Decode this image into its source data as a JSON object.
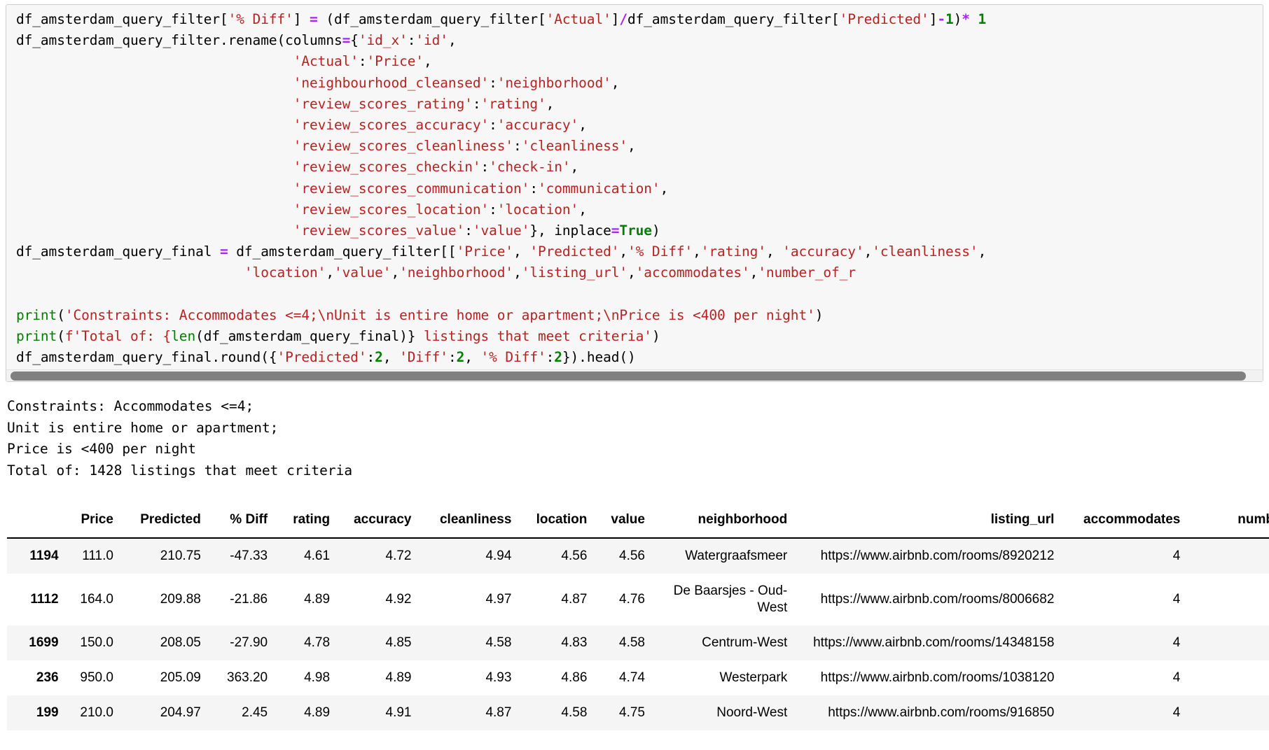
{
  "notebook": {
    "code_cell": {
      "lines": [
        [
          {
            "t": "df_amsterdam_query_filter[",
            "c": "plain"
          },
          {
            "t": "'% Diff'",
            "c": "str"
          },
          {
            "t": "] ",
            "c": "plain"
          },
          {
            "t": "=",
            "c": "op"
          },
          {
            "t": " (df_amsterdam_query_filter[",
            "c": "plain"
          },
          {
            "t": "'Actual'",
            "c": "str"
          },
          {
            "t": "]",
            "c": "plain"
          },
          {
            "t": "/",
            "c": "op"
          },
          {
            "t": "df_amsterdam_query_filter[",
            "c": "plain"
          },
          {
            "t": "'Predicted'",
            "c": "str"
          },
          {
            "t": "]",
            "c": "plain"
          },
          {
            "t": "-",
            "c": "op"
          },
          {
            "t": "1",
            "c": "num"
          },
          {
            "t": ")",
            "c": "plain"
          },
          {
            "t": "*",
            "c": "op"
          },
          {
            "t": " 1",
            "c": "num"
          }
        ],
        [
          {
            "t": "df_amsterdam_query_filter.rename(columns",
            "c": "plain"
          },
          {
            "t": "=",
            "c": "op"
          },
          {
            "t": "{",
            "c": "plain"
          },
          {
            "t": "'id_x'",
            "c": "str"
          },
          {
            "t": ":",
            "c": "plain"
          },
          {
            "t": "'id'",
            "c": "str"
          },
          {
            "t": ",",
            "c": "plain"
          }
        ],
        [
          {
            "t": "                                  ",
            "c": "plain"
          },
          {
            "t": "'Actual'",
            "c": "str"
          },
          {
            "t": ":",
            "c": "plain"
          },
          {
            "t": "'Price'",
            "c": "str"
          },
          {
            "t": ",",
            "c": "plain"
          }
        ],
        [
          {
            "t": "                                  ",
            "c": "plain"
          },
          {
            "t": "'neighbourhood_cleansed'",
            "c": "str"
          },
          {
            "t": ":",
            "c": "plain"
          },
          {
            "t": "'neighborhood'",
            "c": "str"
          },
          {
            "t": ",",
            "c": "plain"
          }
        ],
        [
          {
            "t": "                                  ",
            "c": "plain"
          },
          {
            "t": "'review_scores_rating'",
            "c": "str"
          },
          {
            "t": ":",
            "c": "plain"
          },
          {
            "t": "'rating'",
            "c": "str"
          },
          {
            "t": ",",
            "c": "plain"
          }
        ],
        [
          {
            "t": "                                  ",
            "c": "plain"
          },
          {
            "t": "'review_scores_accuracy'",
            "c": "str"
          },
          {
            "t": ":",
            "c": "plain"
          },
          {
            "t": "'accuracy'",
            "c": "str"
          },
          {
            "t": ",",
            "c": "plain"
          }
        ],
        [
          {
            "t": "                                  ",
            "c": "plain"
          },
          {
            "t": "'review_scores_cleanliness'",
            "c": "str"
          },
          {
            "t": ":",
            "c": "plain"
          },
          {
            "t": "'cleanliness'",
            "c": "str"
          },
          {
            "t": ",",
            "c": "plain"
          }
        ],
        [
          {
            "t": "                                  ",
            "c": "plain"
          },
          {
            "t": "'review_scores_checkin'",
            "c": "str"
          },
          {
            "t": ":",
            "c": "plain"
          },
          {
            "t": "'check-in'",
            "c": "str"
          },
          {
            "t": ",",
            "c": "plain"
          }
        ],
        [
          {
            "t": "                                  ",
            "c": "plain"
          },
          {
            "t": "'review_scores_communication'",
            "c": "str"
          },
          {
            "t": ":",
            "c": "plain"
          },
          {
            "t": "'communication'",
            "c": "str"
          },
          {
            "t": ",",
            "c": "plain"
          }
        ],
        [
          {
            "t": "                                  ",
            "c": "plain"
          },
          {
            "t": "'review_scores_location'",
            "c": "str"
          },
          {
            "t": ":",
            "c": "plain"
          },
          {
            "t": "'location'",
            "c": "str"
          },
          {
            "t": ",",
            "c": "plain"
          }
        ],
        [
          {
            "t": "                                  ",
            "c": "plain"
          },
          {
            "t": "'review_scores_value'",
            "c": "str"
          },
          {
            "t": ":",
            "c": "plain"
          },
          {
            "t": "'value'",
            "c": "str"
          },
          {
            "t": "}, inplace",
            "c": "plain"
          },
          {
            "t": "=",
            "c": "op"
          },
          {
            "t": "True",
            "c": "kw"
          },
          {
            "t": ")",
            "c": "plain"
          }
        ],
        [
          {
            "t": "df_amsterdam_query_final ",
            "c": "plain"
          },
          {
            "t": "=",
            "c": "op"
          },
          {
            "t": " df_amsterdam_query_filter[[",
            "c": "plain"
          },
          {
            "t": "'Price'",
            "c": "str"
          },
          {
            "t": ", ",
            "c": "plain"
          },
          {
            "t": "'Predicted'",
            "c": "str"
          },
          {
            "t": ",",
            "c": "plain"
          },
          {
            "t": "'% Diff'",
            "c": "str"
          },
          {
            "t": ",",
            "c": "plain"
          },
          {
            "t": "'rating'",
            "c": "str"
          },
          {
            "t": ", ",
            "c": "plain"
          },
          {
            "t": "'accuracy'",
            "c": "str"
          },
          {
            "t": ",",
            "c": "plain"
          },
          {
            "t": "'cleanliness'",
            "c": "str"
          },
          {
            "t": ",",
            "c": "plain"
          }
        ],
        [
          {
            "t": "                            ",
            "c": "plain"
          },
          {
            "t": "'location'",
            "c": "str"
          },
          {
            "t": ",",
            "c": "plain"
          },
          {
            "t": "'value'",
            "c": "str"
          },
          {
            "t": ",",
            "c": "plain"
          },
          {
            "t": "'neighborhood'",
            "c": "str"
          },
          {
            "t": ",",
            "c": "plain"
          },
          {
            "t": "'listing_url'",
            "c": "str"
          },
          {
            "t": ",",
            "c": "plain"
          },
          {
            "t": "'accommodates'",
            "c": "str"
          },
          {
            "t": ",",
            "c": "plain"
          },
          {
            "t": "'number_of_r",
            "c": "str"
          }
        ],
        [],
        [
          {
            "t": "print",
            "c": "fn"
          },
          {
            "t": "(",
            "c": "plain"
          },
          {
            "t": "'Constraints: Accommodates <=4;\\nUnit is entire home or apartment;\\nPrice is <400 per night'",
            "c": "str"
          },
          {
            "t": ")",
            "c": "plain"
          }
        ],
        [
          {
            "t": "print",
            "c": "fn"
          },
          {
            "t": "(",
            "c": "plain"
          },
          {
            "t": "f'Total of: {",
            "c": "str"
          },
          {
            "t": "len",
            "c": "fn"
          },
          {
            "t": "(df_amsterdam_query_final)} ",
            "c": "plain"
          },
          {
            "t": "listings that meet criteria'",
            "c": "str"
          },
          {
            "t": ")",
            "c": "plain"
          }
        ],
        [
          {
            "t": "df_amsterdam_query_final.round({",
            "c": "plain"
          },
          {
            "t": "'Predicted'",
            "c": "str"
          },
          {
            "t": ":",
            "c": "plain"
          },
          {
            "t": "2",
            "c": "num"
          },
          {
            "t": ", ",
            "c": "plain"
          },
          {
            "t": "'Diff'",
            "c": "str"
          },
          {
            "t": ":",
            "c": "plain"
          },
          {
            "t": "2",
            "c": "num"
          },
          {
            "t": ", ",
            "c": "plain"
          },
          {
            "t": "'% Diff'",
            "c": "str"
          },
          {
            "t": ":",
            "c": "plain"
          },
          {
            "t": "2",
            "c": "num"
          },
          {
            "t": "}).head()",
            "c": "plain"
          }
        ]
      ]
    },
    "stdout": [
      "Constraints: Accommodates <=4;",
      "Unit is entire home or apartment;",
      "Price is <400 per night",
      "Total of: 1428 listings that meet criteria"
    ],
    "dataframe": {
      "columns": [
        "",
        "Price",
        "Predicted",
        "% Diff",
        "rating",
        "accuracy",
        "cleanliness",
        "location",
        "value",
        "neighborhood",
        "listing_url",
        "accommodates",
        "number_of_"
      ],
      "rows": [
        {
          "index": "1194",
          "cells": [
            "111.0",
            "210.75",
            "-47.33",
            "4.61",
            "4.72",
            "4.94",
            "4.56",
            "4.56",
            "Watergraafsmeer",
            "https://www.airbnb.com/rooms/8920212",
            "4",
            ""
          ]
        },
        {
          "index": "1112",
          "cells": [
            "164.0",
            "209.88",
            "-21.86",
            "4.89",
            "4.92",
            "4.97",
            "4.87",
            "4.76",
            "De Baarsjes - Oud-West",
            "https://www.airbnb.com/rooms/8006682",
            "4",
            ""
          ]
        },
        {
          "index": "1699",
          "cells": [
            "150.0",
            "208.05",
            "-27.90",
            "4.78",
            "4.85",
            "4.58",
            "4.83",
            "4.58",
            "Centrum-West",
            "https://www.airbnb.com/rooms/14348158",
            "4",
            ""
          ]
        },
        {
          "index": "236",
          "cells": [
            "950.0",
            "205.09",
            "363.20",
            "4.98",
            "4.89",
            "4.93",
            "4.86",
            "4.74",
            "Westerpark",
            "https://www.airbnb.com/rooms/1038120",
            "4",
            ""
          ]
        },
        {
          "index": "199",
          "cells": [
            "210.0",
            "204.97",
            "2.45",
            "4.89",
            "4.91",
            "4.87",
            "4.58",
            "4.75",
            "Noord-West",
            "https://www.airbnb.com/rooms/916850",
            "4",
            ""
          ]
        }
      ]
    },
    "colors": {
      "string": "#ba2121",
      "operator": "#aa22ff",
      "number_keyword": "#008000",
      "cell_background": "#f7f7f7",
      "scrollbar_thumb": "#808080",
      "row_stripe": "#f5f5f5"
    }
  }
}
